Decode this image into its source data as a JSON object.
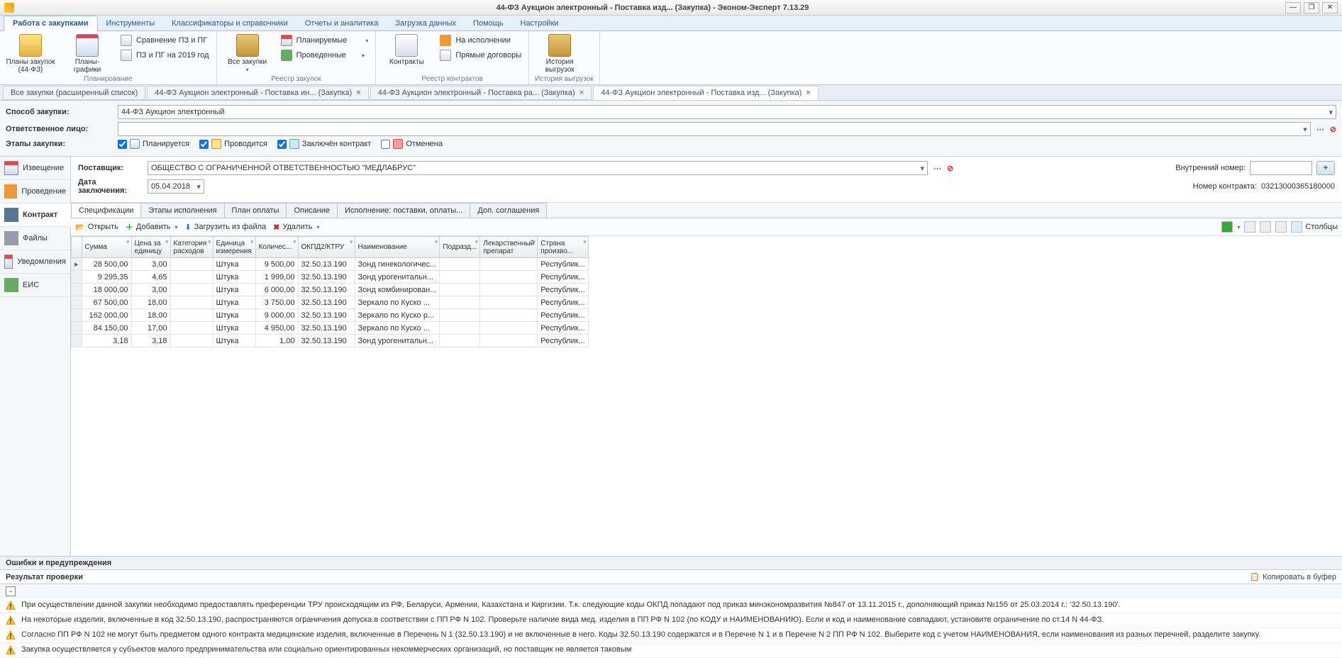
{
  "window": {
    "title": "44-ФЗ Аукцион электронный - Поставка изд... (Закупка) - Эконом-Эксперт 7.13.29"
  },
  "menu": [
    "Работа с закупками",
    "Инструменты",
    "Классификаторы и справочники",
    "Отчеты и аналитика",
    "Загрузка данных",
    "Помощь",
    "Настройки"
  ],
  "ribbon": {
    "g1": {
      "label": "Планирование",
      "big": [
        {
          "t": "Планы закупок\n(44-ФЗ)"
        },
        {
          "t": "Планы-графики"
        }
      ],
      "small": [
        "Сравнение ПЗ и ПГ",
        "ПЗ и ПГ на 2019 год"
      ]
    },
    "g2": {
      "label": "Реестр закупок",
      "big": [
        {
          "t": "Все закупки"
        }
      ],
      "small": [
        "Планируемые",
        "Проведенные"
      ]
    },
    "g3": {
      "label": "Реестр контрактов",
      "big": [
        {
          "t": "Контракты"
        }
      ],
      "small": [
        "На исполнении",
        "Прямые договоры"
      ]
    },
    "g4": {
      "label": "История выгрузок",
      "big": [
        {
          "t": "История\nвыгрузок"
        }
      ]
    }
  },
  "doctabs": [
    "Все закупки (расширенный список)",
    "44-ФЗ Аукцион электронный - Поставка  ин... (Закупка)",
    "44-ФЗ Аукцион электронный - Поставка  ра... (Закупка)",
    "44-ФЗ Аукцион электронный - Поставка изд... (Закупка)"
  ],
  "form": {
    "method_label": "Способ закупки:",
    "method_value": "44-ФЗ Аукцион электронный",
    "resp_label": "Ответственное лицо:",
    "resp_value": "",
    "stages_label": "Этапы закупки:",
    "st1": "Планируется",
    "st2": "Проводится",
    "st3": "Заключён контракт",
    "st4": "Отменена"
  },
  "sidenav": [
    {
      "t": "Извещение"
    },
    {
      "t": "Проведение"
    },
    {
      "t": "Контракт"
    },
    {
      "t": "Файлы"
    },
    {
      "t": "Уведомления"
    },
    {
      "t": "ЕИС"
    }
  ],
  "contract": {
    "supplier_label": "Поставщик:",
    "supplier_value": "ОБЩЕСТВО С ОГРАНИЧЕННОЙ ОТВЕТСТВЕННОСТЬЮ \"МЕДЛАБРУС\"",
    "date_label": "Дата заключения:",
    "date_value": "05.04.2018",
    "intnum_label": "Внутренний номер:",
    "intnum_value": "",
    "cnum_label": "Номер контракта:",
    "cnum_value": "03213000365180000"
  },
  "subtabs": [
    "Спецификации",
    "Этапы исполнения",
    "План оплаты",
    "Описание",
    "Исполнение: поставки, оплаты...",
    "Доп. соглашения"
  ],
  "toolbar": {
    "open": "Открыть",
    "add": "Добавить",
    "load": "Загрузить из файла",
    "del": "Удалить",
    "cols": "Столбцы"
  },
  "gridcols": [
    "Сумма",
    "Цена за единицу",
    "Категория расходов",
    "Единица измерения",
    "Количес...",
    "ОКПД2/КТРУ",
    "Наименование",
    "Подразд...",
    "Лекарственный препарат",
    "Страна произво..."
  ],
  "rows": [
    {
      "sum": "28 500,00",
      "price": "3,00",
      "cat": "",
      "unit": "Штука",
      "qty": "9 500,00",
      "okpd": "32.50.13.190",
      "name": "Зонд гинекологичес...",
      "sub": "",
      "med": "",
      "country": "Республик..."
    },
    {
      "sum": "9 295,35",
      "price": "4,65",
      "cat": "",
      "unit": "Штука",
      "qty": "1 999,00",
      "okpd": "32.50.13.190",
      "name": "Зонд урогенитальн...",
      "sub": "",
      "med": "",
      "country": "Республик..."
    },
    {
      "sum": "18 000,00",
      "price": "3,00",
      "cat": "",
      "unit": "Штука",
      "qty": "6 000,00",
      "okpd": "32.50.13.190",
      "name": "Зонд комбинирован...",
      "sub": "",
      "med": "",
      "country": "Республик..."
    },
    {
      "sum": "67 500,00",
      "price": "18,00",
      "cat": "",
      "unit": "Штука",
      "qty": "3 750,00",
      "okpd": "32.50.13.190",
      "name": "Зеркало  по Куско ...",
      "sub": "",
      "med": "",
      "country": "Республик..."
    },
    {
      "sum": "162 000,00",
      "price": "18,00",
      "cat": "",
      "unit": "Штука",
      "qty": "9 000,00",
      "okpd": "32.50.13.190",
      "name": "Зеркало  по Куско р...",
      "sub": "",
      "med": "",
      "country": "Республик..."
    },
    {
      "sum": "84 150,00",
      "price": "17,00",
      "cat": "",
      "unit": "Штука",
      "qty": "4 950,00",
      "okpd": "32.50.13.190",
      "name": "Зеркало  по Куско ...",
      "sub": "",
      "med": "",
      "country": "Республик..."
    },
    {
      "sum": "3,18",
      "price": "3,18",
      "cat": "",
      "unit": "Штука",
      "qty": "1,00",
      "okpd": "32.50.13.190",
      "name": "Зонд урогенитальн...",
      "sub": "",
      "med": "",
      "country": "Республик..."
    }
  ],
  "errors": {
    "title": "Ошибки и предупреждения",
    "result": "Результат проверки",
    "copy": "Копировать в буфер",
    "items": [
      "При осуществлении данной закупки необходимо предоставлять преференции ТРУ происходящим из РФ, Беларуси, Армении, Казахстана и Киргизии. Т.к. следующие коды ОКПД попадают под приказ минэкономразвития №847 от 13.11.2015 г., дополняющий приказ №155 от 25.03.2014 г.: '32.50.13.190'.",
      "На некоторые изделия, включенные в код 32.50.13.190, распространяются ограничения допуска в соответствии с ПП РФ N 102. Проверьте наличие вида мед. изделия в ПП РФ N 102 (по КОДУ и НАИМЕНОВАНИЮ). Если и код и наименование совпадают, установите ограничение по ст.14 N 44-ФЗ.",
      "Согласно ПП РФ N 102 не могут быть предметом одного контракта медицинские изделия, включенные в Перечень N 1 (32.50.13.190) и не включенные в него. Коды 32.50.13.190 содержатся и в Перечне N 1 и в Перечне N 2 ПП РФ N 102. Выберите код с учетом НАИМЕНОВАНИЯ, если наименования из разных перечней, разделите закупку.",
      "Закупка осуществляется у субъектов малого предпринимательства или социально ориентированных некоммерческих организаций, но поставщик не является таковым"
    ]
  }
}
